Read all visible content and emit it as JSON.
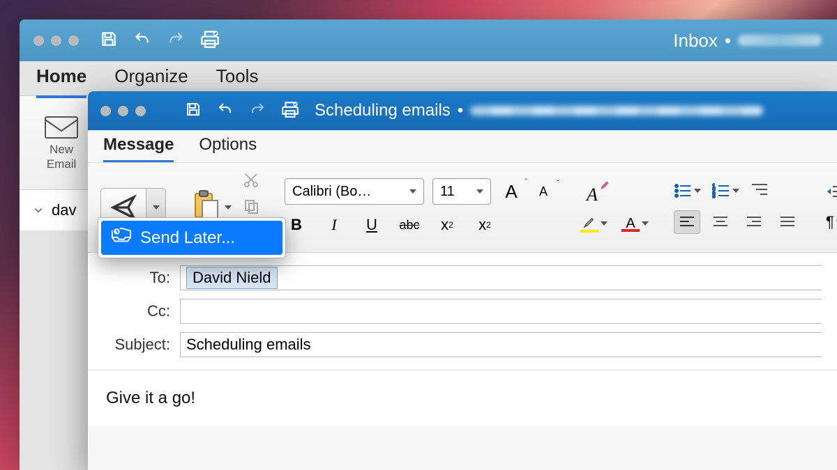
{
  "back": {
    "title": "Inbox",
    "tabs": {
      "home": "Home",
      "organize": "Organize",
      "tools": "Tools"
    },
    "new_email_line1": "New",
    "new_email_line2": "Email",
    "folder_prefix": "dav"
  },
  "front": {
    "title": "Scheduling emails",
    "tabs": {
      "message": "Message",
      "options": "Options"
    },
    "send_menu": {
      "send_later": "Send Later..."
    },
    "font": {
      "name": "Calibri (Bo…",
      "size": "11"
    },
    "format": {
      "bold": "B",
      "italic": "I",
      "underline": "U",
      "strike": "abc",
      "subscript_base": "x",
      "subscript_sub": "2",
      "superscript_base": "x",
      "superscript_sup": "2",
      "bigA": "A",
      "smallA": "A",
      "clearA": "A",
      "highlightA": "A",
      "fontColorA": "A"
    },
    "headers": {
      "to_label": "To:",
      "to_chip": "David Nield",
      "cc_label": "Cc:",
      "cc_value": "",
      "subject_label": "Subject:",
      "subject_value": "Scheduling emails"
    },
    "body": "Give it a go!",
    "colors": {
      "highlight": "#ffeb00",
      "font_color": "#e02424"
    }
  }
}
